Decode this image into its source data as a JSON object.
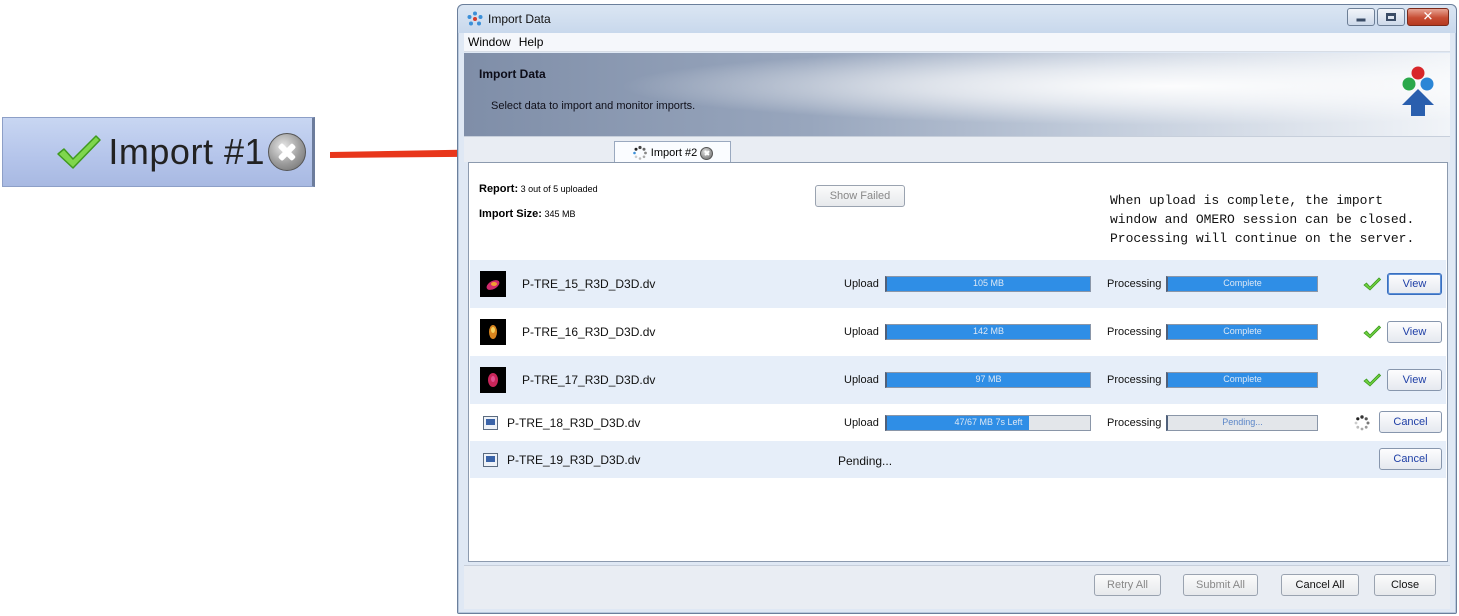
{
  "callout": {
    "label": "Import #1"
  },
  "window": {
    "title": "Import Data",
    "menu": [
      "Window",
      "Help"
    ]
  },
  "banner": {
    "title": "Import Data",
    "subtitle": "Select data to import and monitor imports."
  },
  "tabs": {
    "active_label": "Import #2"
  },
  "summary": {
    "report_label": "Report:",
    "report_value": "3 out of 5 uploaded",
    "size_label": "Import Size:",
    "size_value": "345 MB",
    "show_failed": "Show Failed",
    "notice_lines": [
      "When upload is complete, the import",
      "window and OMERO session can be closed.",
      "Processing will continue on the server."
    ]
  },
  "files": [
    {
      "name": "P-TRE_15_R3D_D3D.dv",
      "upload_label": "Upload",
      "upload_text": "105 MB",
      "upload_progress": 1.0,
      "processing_label": "Processing",
      "processing_text": "Complete",
      "processing_progress": 1.0,
      "status": "done",
      "action": "View"
    },
    {
      "name": "P-TRE_16_R3D_D3D.dv",
      "upload_label": "Upload",
      "upload_text": "142 MB",
      "upload_progress": 1.0,
      "processing_label": "Processing",
      "processing_text": "Complete",
      "processing_progress": 1.0,
      "status": "done",
      "action": "View"
    },
    {
      "name": "P-TRE_17_R3D_D3D.dv",
      "upload_label": "Upload",
      "upload_text": "97 MB",
      "upload_progress": 1.0,
      "processing_label": "Processing",
      "processing_text": "Complete",
      "processing_progress": 1.0,
      "status": "done",
      "action": "View"
    },
    {
      "name": "P-TRE_18_R3D_D3D.dv",
      "upload_label": "Upload",
      "upload_text": "47/67 MB  7s Left",
      "upload_progress": 0.7,
      "processing_label": "Processing",
      "processing_text": "Pending...",
      "processing_progress": 0.0,
      "status": "uploading",
      "action": "Cancel"
    },
    {
      "name": "P-TRE_19_R3D_D3D.dv",
      "pending_text": "Pending...",
      "status": "queued",
      "action": "Cancel"
    }
  ],
  "footer": {
    "retry_all": "Retry All",
    "submit_all": "Submit All",
    "cancel_all": "Cancel All",
    "close": "Close"
  },
  "colors": {
    "progress_fill": "#2f8ee6",
    "check_green": "#5fc23a",
    "arrow_red": "#e8361b"
  }
}
